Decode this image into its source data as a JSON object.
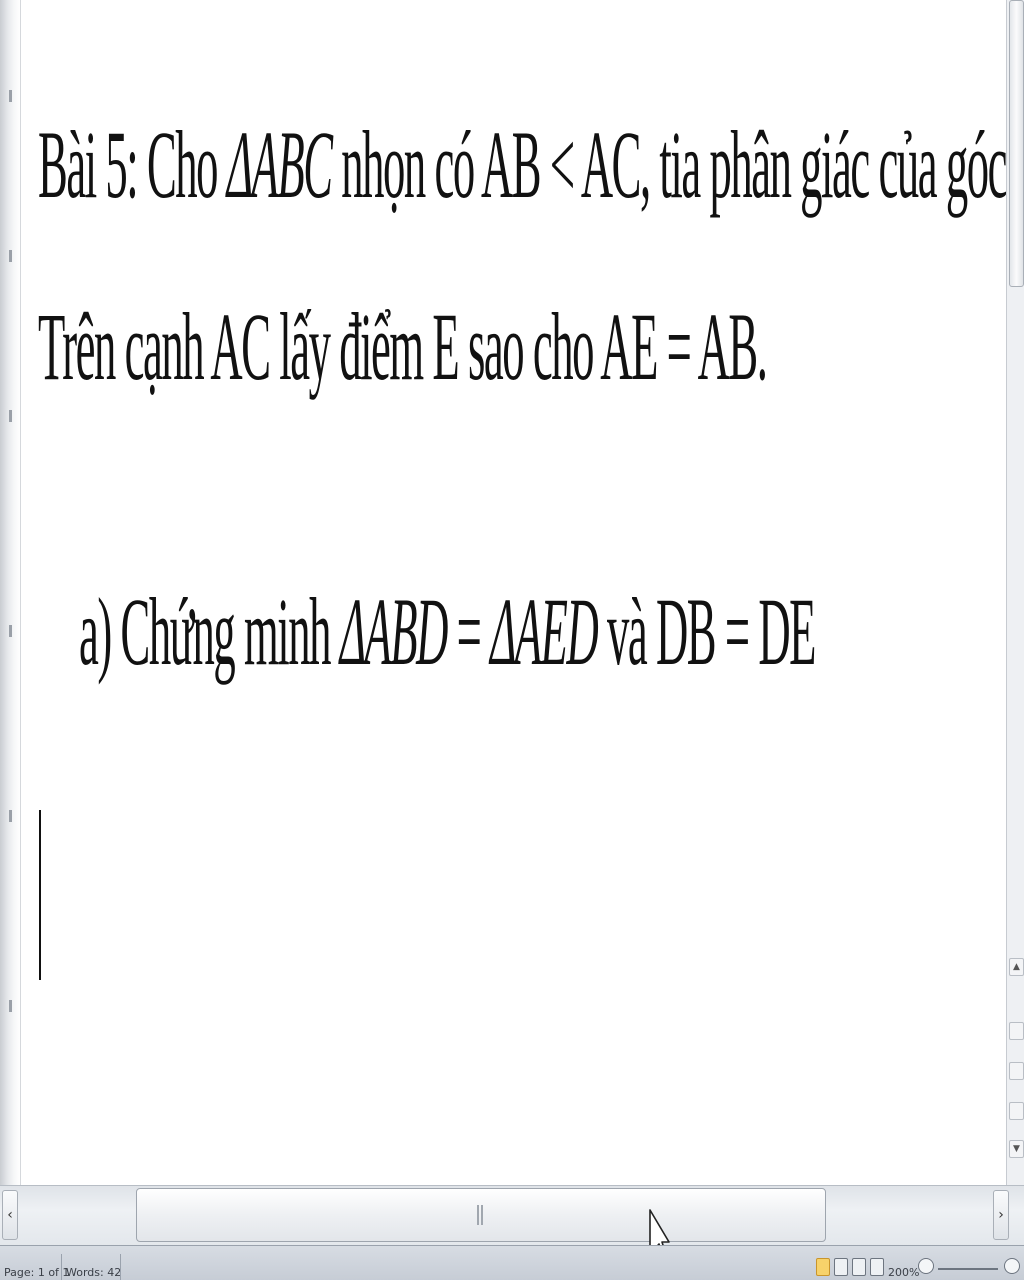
{
  "document": {
    "line1": {
      "part1": "Bài 5: Cho ",
      "triangle_abc": "ΔABC",
      "part2": " nhọn có AB < AC, tia phân giác của góc A cắt cạnh BC tại D"
    },
    "line2": "Trên cạnh AC lấy điểm E sao cho AE = AB.",
    "line3": {
      "prefix": "a) Chứng minh ",
      "triangle_abd": "ΔABD",
      "eq": " = ",
      "triangle_aed": "ΔAED",
      "suffix": " và DB = DE"
    }
  },
  "scrollbars": {
    "left_arrow": "‹",
    "right_arrow": "›",
    "up_arrow": "▲",
    "down_arrow": "▼"
  },
  "statusbar": {
    "page": "Page: 1 of 1",
    "words": "Words: 42",
    "zoom": "200%"
  },
  "colors": {
    "text": "#111111",
    "statusbar_bg": "#c6ccd5",
    "active_view": "#f7d26a"
  }
}
